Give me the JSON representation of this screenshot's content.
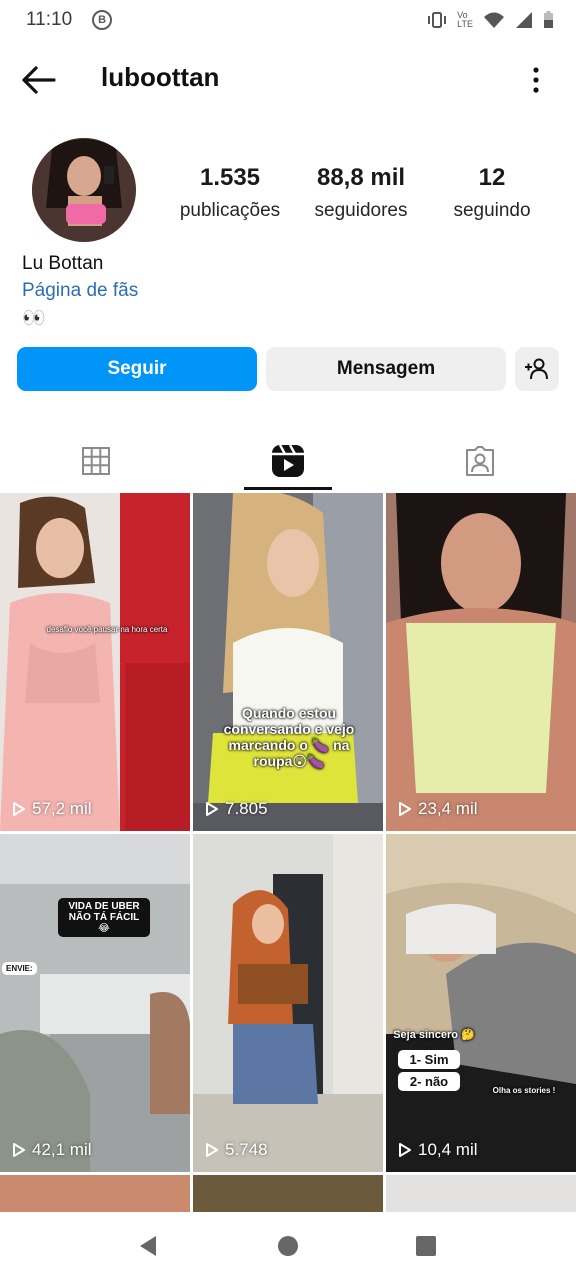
{
  "status_bar": {
    "time": "11:10",
    "badge": "B",
    "volte_top": "Vo",
    "volte_bottom": "LTE"
  },
  "header": {
    "username": "luboottan",
    "back_icon": "arrow-left-icon",
    "more_icon": "more-vertical-icon"
  },
  "profile": {
    "stats": {
      "posts": {
        "value": "1.535",
        "label": "publicações"
      },
      "followers": {
        "value": "88,8 mil",
        "label": "seguidores"
      },
      "following": {
        "value": "12",
        "label": "seguindo"
      }
    },
    "display_name": "Lu Bottan",
    "category": "Página de fãs",
    "bio": "👀"
  },
  "actions": {
    "follow_label": "Seguir",
    "message_label": "Mensagem",
    "add_user_icon": "person-add-icon"
  },
  "tabs": [
    {
      "icon": "grid-icon",
      "active": false
    },
    {
      "icon": "reels-icon",
      "active": true
    },
    {
      "icon": "tagged-icon",
      "active": false
    }
  ],
  "reels": [
    {
      "views": "57,2 mil",
      "caption": "desafio você pausar na hora certa"
    },
    {
      "views": "7.805",
      "caption": "Quando estou conversando e vejo marcando o 🍆 na roupa😲🍆"
    },
    {
      "views": "23,4 mil",
      "caption": ""
    },
    {
      "views": "42,1 mil",
      "caption": "VIDA DE UBER NÃO TÁ FÁCIL 😂",
      "extra": "ENVIE:"
    },
    {
      "views": "5.748",
      "caption": ""
    },
    {
      "views": "10,4 mil",
      "caption": "Seja sincero 🤔",
      "option1": "1- Sim",
      "option2": "2- não",
      "note": "Olha os stories !"
    }
  ],
  "colors": {
    "accent": "#0095f6",
    "link": "#2a6fb5",
    "secondary_button": "#efefef"
  }
}
